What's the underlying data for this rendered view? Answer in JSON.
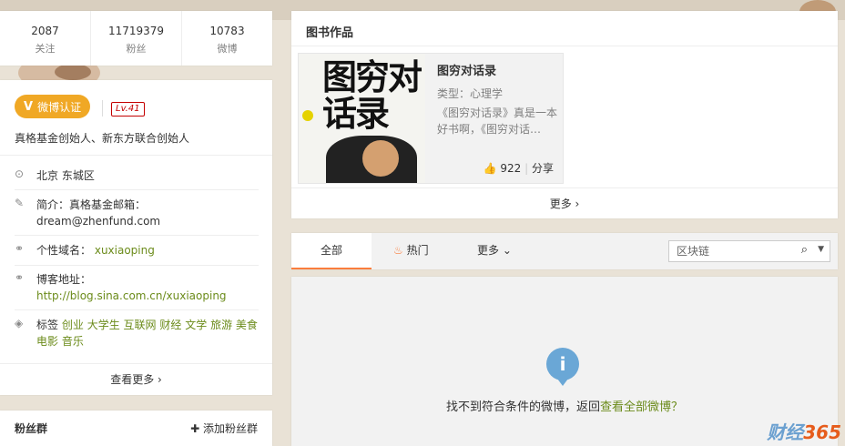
{
  "counts": [
    {
      "num": "2087",
      "label": "关注"
    },
    {
      "num": "11719379",
      "label": "粉丝"
    },
    {
      "num": "10783",
      "label": "微博"
    }
  ],
  "profile": {
    "verify_label": "微博认证",
    "verify_mark": "V",
    "level": "Lv.41",
    "description": "真格基金创始人、新东方联合创始人",
    "location": "北京 东城区",
    "intro_label": "简介：",
    "intro_text": "真格基金邮箱：dream@zhenfund.com",
    "domain_label": "个性域名：",
    "domain_value": "xuxiaoping",
    "blog_label": "博客地址：",
    "blog_value": "http://blog.sina.com.cn/xuxiaoping",
    "tags_label": "标签",
    "tags": [
      "创业",
      "大学生",
      "互联网",
      "财经",
      "文学",
      "旅游",
      "美食",
      "电影",
      "音乐"
    ],
    "more": "查看更多 ›"
  },
  "fans": {
    "title": "粉丝群",
    "add": "添加粉丝群"
  },
  "books": {
    "header": "图书作品",
    "cover_text": "图穷对话录",
    "title": "图穷对话录",
    "type": "类型：心理学",
    "desc": "《图穷对话录》真是一本好书啊，《图穷对话…",
    "likes": "922",
    "share": "分享",
    "more": "更多 ›"
  },
  "feed": {
    "tabs": [
      "全部",
      "热门",
      "更多"
    ],
    "search_placeholder": "区块链",
    "empty_prefix": "找不到符合条件的微博，返回",
    "empty_link": "查看全部微博？"
  },
  "watermark": {
    "a": "财经",
    "b": "365"
  },
  "colors": {
    "accent": "#fa7d3c",
    "verify": "#f0a825",
    "link": "#6b8b1a",
    "info": "#6aa7d6"
  }
}
